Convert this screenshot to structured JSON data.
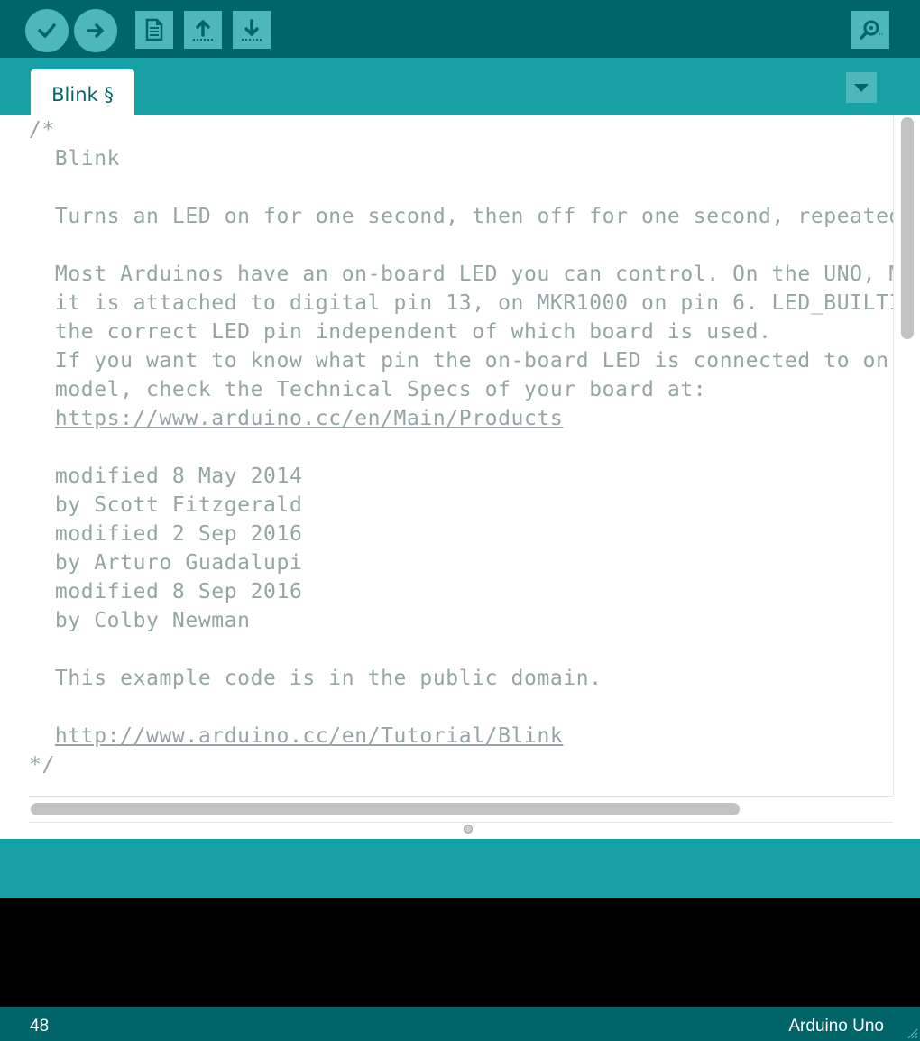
{
  "toolbar": {
    "buttons": [
      {
        "name": "verify",
        "icon": "check-icon"
      },
      {
        "name": "upload",
        "icon": "arrow-right-icon"
      },
      {
        "name": "new",
        "icon": "document-icon"
      },
      {
        "name": "open",
        "icon": "arrow-up-icon"
      },
      {
        "name": "save",
        "icon": "arrow-down-icon"
      },
      {
        "name": "serial-monitor",
        "icon": "magnifier-icon"
      }
    ]
  },
  "tabs": [
    {
      "label": "Blink §",
      "active": true
    }
  ],
  "editor": {
    "lines": [
      "/*",
      "  Blink",
      "",
      "  Turns an LED on for one second, then off for one second, repeatedly.",
      "",
      "  Most Arduinos have an on-board LED you can control. On the UNO, MEGA and ZERO",
      "  it is attached to digital pin 13, on MKR1000 on pin 6. LED_BUILTIN is set to",
      "  the correct LED pin independent of which board is used.",
      "  If you want to know what pin the on-board LED is connected to on your Arduino",
      "  model, check the Technical Specs of your board at:",
      "  https://www.arduino.cc/en/Main/Products",
      "",
      "  modified 8 May 2014",
      "  by Scott Fitzgerald",
      "  modified 2 Sep 2016",
      "  by Arturo Guadalupi",
      "  modified 8 Sep 2016",
      "  by Colby Newman",
      "",
      "  This example code is in the public domain.",
      "",
      "  http://www.arduino.cc/en/Tutorial/Blink",
      "*/"
    ],
    "link_lines": [
      10,
      21
    ]
  },
  "message": {
    "text": ""
  },
  "status": {
    "line_number": "48",
    "board": "Arduino Uno"
  },
  "colors": {
    "toolbar_bg": "#006468",
    "tabbar_bg": "#17a1a5",
    "button_bg": "#4db7bb",
    "code_comment": "#95a5a6",
    "console_bg": "#000000"
  }
}
